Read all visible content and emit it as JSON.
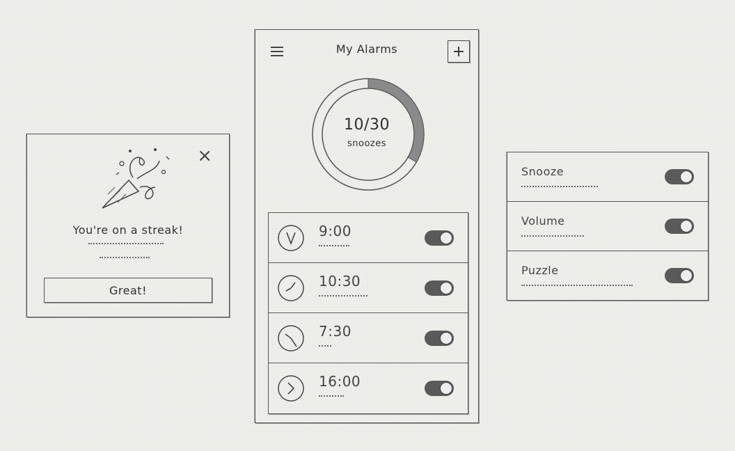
{
  "popup": {
    "title": "You're on a streak!",
    "button_label": "Great!",
    "close_label": "×"
  },
  "phone": {
    "header": {
      "title": "My Alarms",
      "add_label": "+"
    },
    "snoozes": {
      "count_text": "10/30",
      "label": "snoozes",
      "used": 10,
      "total": 30
    },
    "alarms": [
      {
        "time": "9:00",
        "enabled": true,
        "clock_icon": "clock-9-icon"
      },
      {
        "time": "10:30",
        "enabled": true,
        "clock_icon": "clock-1030-icon"
      },
      {
        "time": "7:30",
        "enabled": true,
        "clock_icon": "clock-730-icon"
      },
      {
        "time": "16:00",
        "enabled": true,
        "clock_icon": "clock-16-icon"
      }
    ]
  },
  "settings": [
    {
      "label": "Snooze",
      "enabled": true
    },
    {
      "label": "Volume",
      "enabled": true
    },
    {
      "label": "Puzzle",
      "enabled": true
    }
  ],
  "colors": {
    "ink": "#444444",
    "toggle_on": "#5a5a5a",
    "paper": "#efefec"
  }
}
